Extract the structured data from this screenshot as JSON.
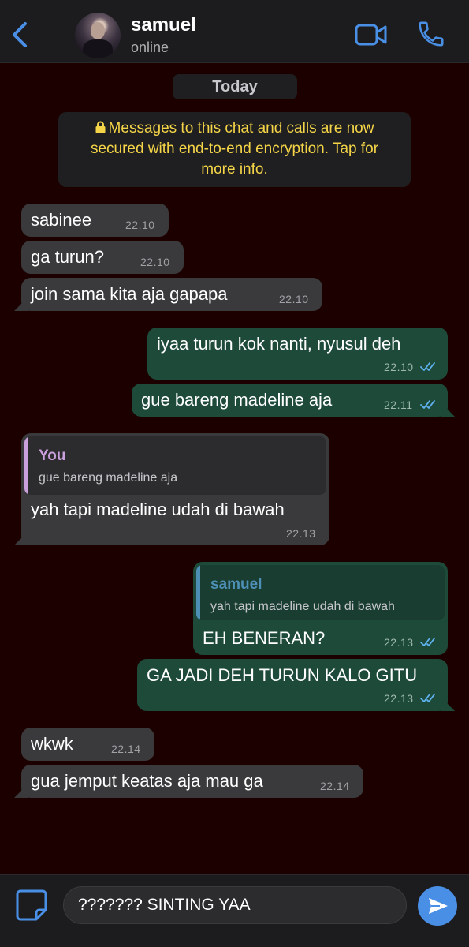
{
  "header": {
    "contact_name": "samuel",
    "status": "online",
    "accent_color": "#4a8fe6",
    "icons": [
      "chevron-left-icon",
      "video-camera-icon",
      "phone-icon"
    ]
  },
  "date_label": "Today",
  "encryption_notice": "Messages to this chat and calls are now secured with end-to-end encryption. Tap for more info.",
  "messages": [
    {
      "direction": "in",
      "text": "sabinee",
      "time": "22.10"
    },
    {
      "direction": "in",
      "text": "ga turun?",
      "time": "22.10"
    },
    {
      "direction": "in",
      "text": "join sama kita aja gapapa",
      "time": "22.10"
    },
    {
      "direction": "out",
      "text": "iyaa turun kok nanti, nyusul deh",
      "time": "22.10",
      "read": true
    },
    {
      "direction": "out",
      "text": "gue bareng madeline aja",
      "time": "22.11",
      "read": true
    },
    {
      "direction": "in",
      "reply_author": "You",
      "reply_text": "gue bareng madeline aja",
      "text": "yah tapi madeline udah di bawah",
      "time": "22.13"
    },
    {
      "direction": "out",
      "reply_author": "samuel",
      "reply_text": "yah tapi madeline udah di bawah",
      "text": "EH BENERAN?",
      "time": "22.13",
      "read": true
    },
    {
      "direction": "out",
      "text": "GA JADI DEH TURUN KALO GITU",
      "time": "22.13",
      "read": true
    },
    {
      "direction": "in",
      "text": "wkwk",
      "time": "22.14"
    },
    {
      "direction": "in",
      "text": "gua jemput keatas aja mau ga",
      "time": "22.14"
    }
  ],
  "composer": {
    "input_value": "??????? SINTING YAA",
    "icons": [
      "sticker-icon",
      "send-icon"
    ]
  },
  "colors": {
    "background": "#1c0000",
    "incoming_bubble": "#3a3a3c",
    "outgoing_bubble": "#1e4a3a",
    "notice_text": "#f5d547",
    "read_ticks": "#5fb3f0",
    "reply_you": "#c9a0dc",
    "reply_samuel": "#4d8fb5"
  }
}
